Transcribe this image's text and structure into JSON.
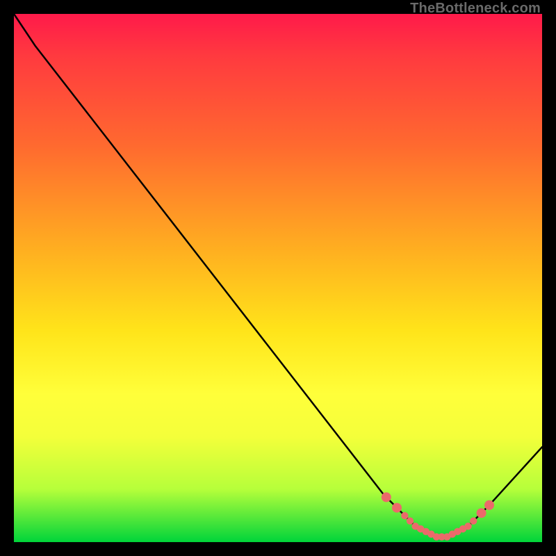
{
  "watermark": "TheBottleneck.com",
  "chart_data": {
    "type": "line",
    "title": "",
    "xlabel": "",
    "ylabel": "",
    "x": [
      0,
      4,
      70,
      72,
      74,
      76,
      78,
      80,
      82,
      84,
      86,
      88,
      90,
      100
    ],
    "values": [
      100,
      94,
      9,
      7,
      5,
      3,
      2,
      1,
      1,
      2,
      3,
      5,
      7,
      18
    ],
    "xlim": [
      0,
      100
    ],
    "ylim": [
      0,
      100
    ],
    "highlight_dots_x": [
      70.5,
      72.5,
      74,
      75,
      76,
      77,
      78,
      79,
      80,
      81,
      82,
      83,
      84,
      85,
      86,
      87,
      88.5,
      90
    ]
  }
}
